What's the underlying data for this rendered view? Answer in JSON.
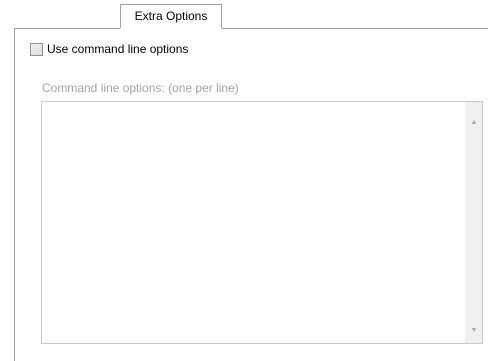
{
  "tabs": {
    "active_label": "Extra Options"
  },
  "options": {
    "use_cmdline_label": "Use command line options",
    "use_cmdline_checked": false,
    "cmdline_label": "Command line options:  (one per line)",
    "cmdline_value": ""
  },
  "scrollbar": {
    "up_icon": "arrow-up-icon",
    "down_icon": "arrow-down-icon",
    "up_glyph": "▲",
    "down_glyph": "▼"
  }
}
